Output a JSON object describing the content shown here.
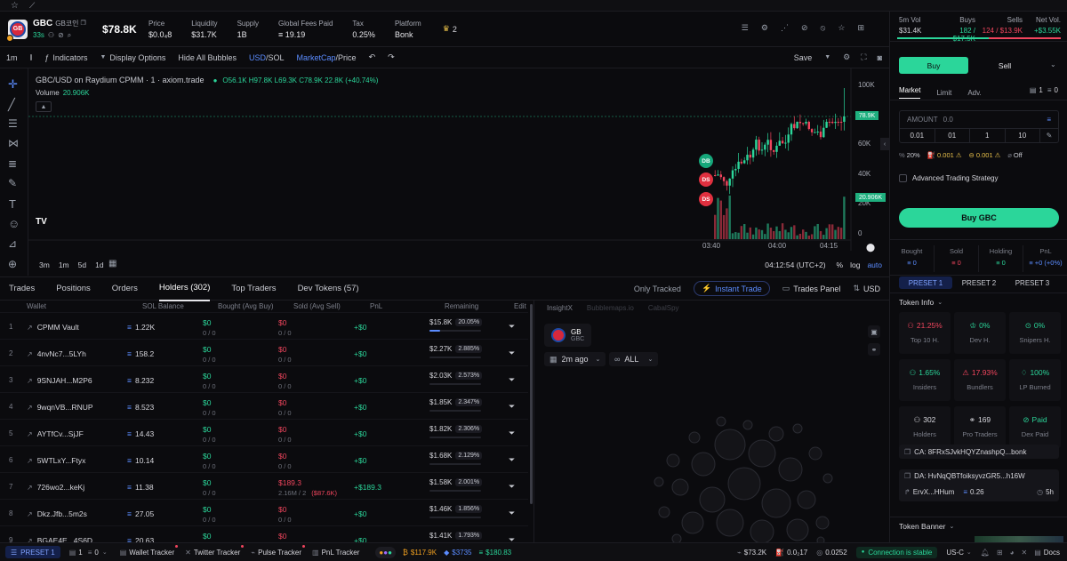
{
  "token": {
    "symbol": "GBC",
    "name": "GB코인",
    "age": "33s",
    "logo_text": "GB",
    "price_usd": "$78.8K"
  },
  "header_stats": [
    {
      "label": "Price",
      "value": "$0.0₄8"
    },
    {
      "label": "Liquidity",
      "value": "$31.7K"
    },
    {
      "label": "Supply",
      "value": "1B"
    },
    {
      "label": "Global Fees Paid",
      "value": "≡ 19.19"
    },
    {
      "label": "Tax",
      "value": "0.25%"
    },
    {
      "label": "Platform",
      "value": "Bonk"
    }
  ],
  "crown_count": "2",
  "toolbar": {
    "interval": "1m",
    "indicators": "Indicators",
    "display_options": "Display Options",
    "hide_bubbles": "Hide All Bubbles",
    "usd": "USD",
    "sol": "SOL",
    "marketcap": "MarketCap",
    "price": "Price",
    "save": "Save"
  },
  "chart_info": {
    "pair": "GBC/USD on Raydium CPMM · 1 · axiom.trade",
    "ohlc": "O56.1K H97.8K L69.3K C78.9K 22.8K (+40.74%)",
    "volume_label": "Volume",
    "volume_value": "20.906K",
    "marker_db": "DB",
    "marker_ds1": "DS",
    "marker_ds2": "DS",
    "tv_logo": "TV",
    "time_readout": "04:12:54 (UTC+2)",
    "pct": "%",
    "log": "log",
    "auto": "auto",
    "ranges": [
      "3m",
      "1m",
      "5d",
      "1d"
    ]
  },
  "chart_data": {
    "type": "bar",
    "yticks": [
      "100K",
      "80K",
      "60K",
      "40K",
      "20K",
      "0"
    ],
    "xticks": [
      "03:40",
      "04:00",
      "04:15"
    ],
    "price_tag": "78.9K",
    "volume_tag": "20.906K"
  },
  "tabs": [
    {
      "label": "Trades"
    },
    {
      "label": "Positions"
    },
    {
      "label": "Orders"
    },
    {
      "label": "Holders (302)"
    },
    {
      "label": "Top Traders"
    },
    {
      "label": "Dev Tokens (57)"
    }
  ],
  "tabs_right": {
    "only_tracked": "Only Tracked",
    "instant_trade": "Instant Trade",
    "trades_panel": "Trades Panel",
    "usd": "USD"
  },
  "holder_columns": [
    "Wallet",
    "SOL Balance",
    "Bought (Avg Buy)",
    "Sold (Avg Sell)",
    "PnL",
    "Remaining",
    "Edit"
  ],
  "holders": [
    {
      "n": "1",
      "wallet": "CPMM Vault",
      "sol": "1.22K",
      "bought": "$0",
      "bought_sub": "0 / 0",
      "sold": "$0",
      "sold_sub": "0 / 0",
      "sold_extra": "",
      "pnl": "+$0",
      "remaining": "$15.8K",
      "pct": "20.05%",
      "fill": 0.2
    },
    {
      "n": "2",
      "wallet": "4nvNc7...5LYh",
      "sol": "158.2",
      "bought": "$0",
      "bought_sub": "0 / 0",
      "sold": "$0",
      "sold_sub": "0 / 0",
      "sold_extra": "",
      "pnl": "+$0",
      "remaining": "$2.27K",
      "pct": "2.885%",
      "fill": 0
    },
    {
      "n": "3",
      "wallet": "9SNJAH...M2P6",
      "sol": "8.232",
      "bought": "$0",
      "bought_sub": "0 / 0",
      "sold": "$0",
      "sold_sub": "0 / 0",
      "sold_extra": "",
      "pnl": "+$0",
      "remaining": "$2.03K",
      "pct": "2.573%",
      "fill": 0
    },
    {
      "n": "4",
      "wallet": "9wqnVB...RNUP",
      "sol": "8.523",
      "bought": "$0",
      "bought_sub": "0 / 0",
      "sold": "$0",
      "sold_sub": "0 / 0",
      "sold_extra": "",
      "pnl": "+$0",
      "remaining": "$1.85K",
      "pct": "2.347%",
      "fill": 0
    },
    {
      "n": "5",
      "wallet": "AYTfCv...SjJF",
      "sol": "14.43",
      "bought": "$0",
      "bought_sub": "0 / 0",
      "sold": "$0",
      "sold_sub": "0 / 0",
      "sold_extra": "",
      "pnl": "+$0",
      "remaining": "$1.82K",
      "pct": "2.306%",
      "fill": 0
    },
    {
      "n": "6",
      "wallet": "5WTLxY...Ftyx",
      "sol": "10.14",
      "bought": "$0",
      "bought_sub": "0 / 0",
      "sold": "$0",
      "sold_sub": "0 / 0",
      "sold_extra": "",
      "pnl": "+$0",
      "remaining": "$1.68K",
      "pct": "2.129%",
      "fill": 0
    },
    {
      "n": "7",
      "wallet": "726wo2...keKj",
      "sol": "11.38",
      "bought": "$0",
      "bought_sub": "0 / 0",
      "sold": "$189.3",
      "sold_sub": "2.16M / 2",
      "sold_extra": "($87.6K)",
      "pnl": "+$189.3",
      "remaining": "$1.58K",
      "pct": "2.001%",
      "fill": 0
    },
    {
      "n": "8",
      "wallet": "Dkz.Jfb...5m2s",
      "sol": "27.05",
      "bought": "$0",
      "bought_sub": "0 / 0",
      "sold": "$0",
      "sold_sub": "0 / 0",
      "sold_extra": "",
      "pnl": "+$0",
      "remaining": "$1.46K",
      "pct": "1.856%",
      "fill": 0
    },
    {
      "n": "9",
      "wallet": "BGAE4E...4S6D",
      "sol": "20.63",
      "bought": "$0",
      "bought_sub": "0 / 0",
      "sold": "$0",
      "sold_sub": "0 / 0",
      "sold_extra": "",
      "pnl": "+$0",
      "remaining": "$1.41K",
      "pct": "1.793%",
      "fill": 0
    }
  ],
  "insight": {
    "tabs": [
      "InsightX",
      "Bubblemaps.io",
      "CabalSpy"
    ],
    "token_symbol": "GB",
    "token_sub": "GBC",
    "time_filter": "2m ago",
    "scope": "ALL"
  },
  "right_panel": {
    "vol_label": "5m Vol",
    "vol_value": "$31.4K",
    "buys_label": "Buys",
    "buys_value": "182 / $17.5K",
    "sells_label": "Sells",
    "sells_value": "124 / $13.9K",
    "net_label": "Net Vol.",
    "net_value": "+$3.55K",
    "buy": "Buy",
    "sell": "Sell",
    "order_tabs": [
      "Market",
      "Limit",
      "Adv."
    ],
    "wallet_count": "1",
    "wallet_value": "0",
    "amount_label": "AMOUNT",
    "amount_placeholder": "0.0",
    "quick_amounts": [
      "0.01",
      "01",
      "1",
      "10"
    ],
    "slippage": "20%",
    "priority": "0.001",
    "bribe": "0.001",
    "mev": "Off",
    "advanced": "Advanced Trading Strategy",
    "buy_button": "Buy GBC",
    "pos_labels": [
      "Bought",
      "Sold",
      "Holding",
      "PnL"
    ],
    "pos_values": [
      "0",
      "0",
      "0",
      "+0 (+0%)"
    ],
    "presets": [
      "PRESET 1",
      "PRESET 2",
      "PRESET 3"
    ],
    "token_info_title": "Token Info",
    "info": [
      {
        "value": "21.25%",
        "label": "Top 10 H.",
        "color": "#f0455d"
      },
      {
        "value": "0%",
        "label": "Dev H.",
        "color": "#2bd69a"
      },
      {
        "value": "0%",
        "label": "Snipers H.",
        "color": "#2bd69a"
      },
      {
        "value": "1.65%",
        "label": "Insiders",
        "color": "#2bd69a"
      },
      {
        "value": "17.93%",
        "label": "Bundlers",
        "color": "#f0455d"
      },
      {
        "value": "100%",
        "label": "LP Burned",
        "color": "#2bd69a"
      },
      {
        "value": "302",
        "label": "Holders",
        "color": "#d6d6dc"
      },
      {
        "value": "169",
        "label": "Pro Traders",
        "color": "#d6d6dc"
      },
      {
        "value": "Paid",
        "label": "Dex Paid",
        "color": "#2bd69a"
      }
    ],
    "ca": "CA: 8FRxSJvkHQYZnashpQ...bonk",
    "da": "DA: HvNqQBTfoiksyvzGR5...h16W",
    "dev_wallet": "ErvX...HHum",
    "dev_sol": "0.26",
    "dev_age": "5h",
    "banner_title": "Token Banner"
  },
  "bottom": {
    "preset": "PRESET 1",
    "wallets": "1",
    "wallets_val": "0",
    "items": [
      "Wallet Tracker",
      "Twitter Tracker",
      "Pulse Tracker",
      "PnL Tracker"
    ],
    "btc": "$117.9K",
    "eth": "$3735",
    "sol": "$180.83",
    "mcap": "$73.2K",
    "gas": "0.0₂17",
    "fee": "0.0252",
    "connection": "Connection is stable",
    "region": "US-C",
    "docs": "Docs"
  }
}
